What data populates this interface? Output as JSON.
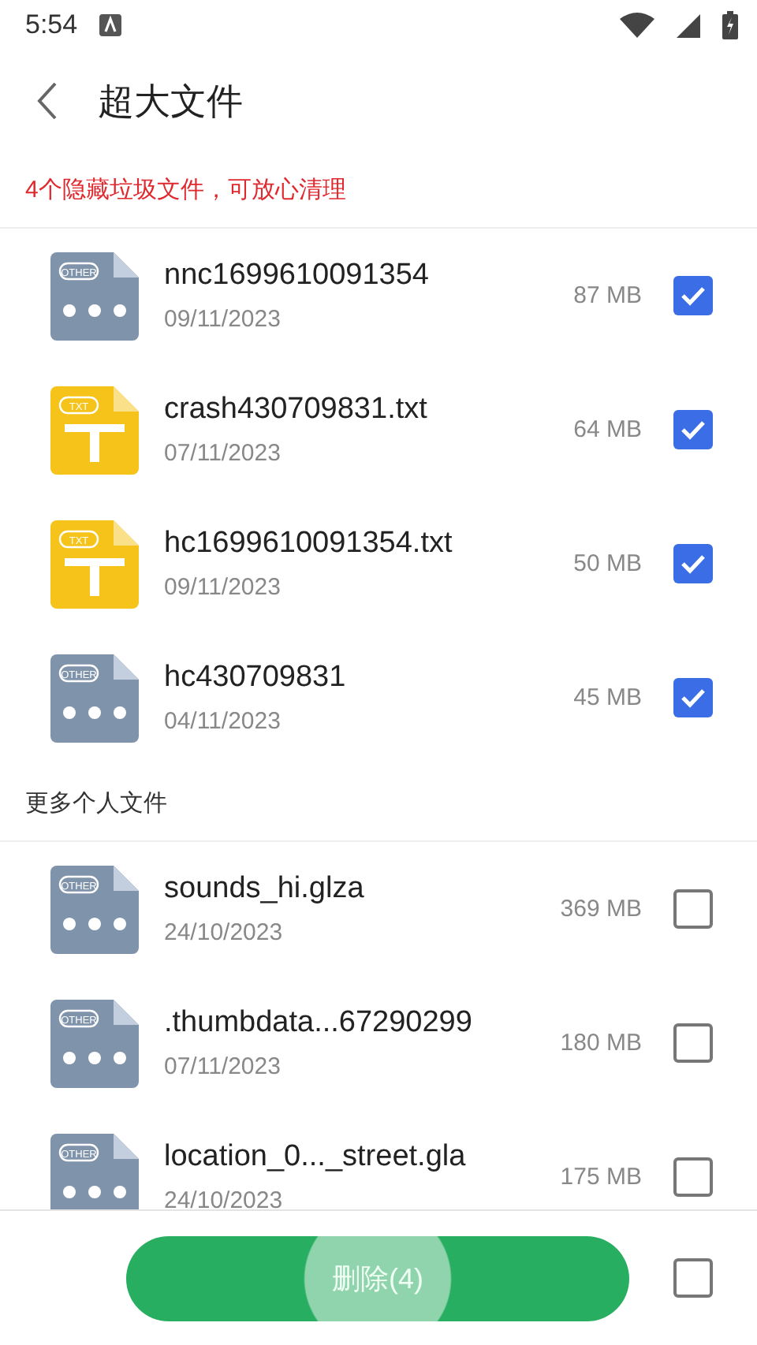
{
  "status_bar": {
    "time": "5:54"
  },
  "header": {
    "title": "超大文件"
  },
  "sections": [
    {
      "kind": "warning",
      "title": "4个隐藏垃圾文件，可放心清理",
      "files": [
        {
          "kind": "other",
          "badge": "OTHER",
          "name": "nnc1699610091354",
          "date": "09/11/2023",
          "size": "87 MB",
          "checked": true
        },
        {
          "kind": "txt",
          "badge": "TXT",
          "name": "crash430709831.txt",
          "date": "07/11/2023",
          "size": "64 MB",
          "checked": true
        },
        {
          "kind": "txt",
          "badge": "TXT",
          "name": "hc1699610091354.txt",
          "date": "09/11/2023",
          "size": "50 MB",
          "checked": true
        },
        {
          "kind": "other",
          "badge": "OTHER",
          "name": "hc430709831",
          "date": "04/11/2023",
          "size": "45 MB",
          "checked": true
        }
      ]
    },
    {
      "kind": "plain",
      "title": "更多个人文件",
      "files": [
        {
          "kind": "other",
          "badge": "OTHER",
          "name": "sounds_hi.glza",
          "date": "24/10/2023",
          "size": "369 MB",
          "checked": false
        },
        {
          "kind": "other",
          "badge": "OTHER",
          "name": ".thumbdata...67290299",
          "date": "07/11/2023",
          "size": "180 MB",
          "checked": false
        },
        {
          "kind": "other",
          "badge": "OTHER",
          "name": "location_0..._street.gla",
          "date": "24/10/2023",
          "size": "175 MB",
          "checked": false
        }
      ]
    }
  ],
  "footer": {
    "delete_button": "删除(4)",
    "select_all": {
      "checked": false
    }
  }
}
